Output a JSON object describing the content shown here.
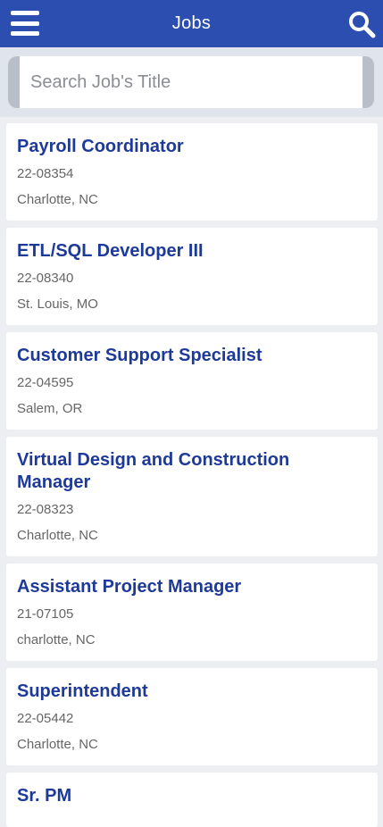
{
  "header": {
    "title": "Jobs",
    "menu_icon": "hamburger-menu-icon",
    "search_icon": "search-icon",
    "bar_color": "#2b4eb0"
  },
  "search": {
    "placeholder": "Search Job's Title",
    "value": ""
  },
  "jobs": [
    {
      "title": "Payroll Coordinator",
      "code": "22-08354",
      "location": "Charlotte, NC"
    },
    {
      "title": "ETL/SQL Developer III",
      "code": "22-08340",
      "location": "St. Louis, MO"
    },
    {
      "title": "Customer Support Specialist",
      "code": "22-04595",
      "location": "Salem, OR"
    },
    {
      "title": "Virtual Design and Construction Manager",
      "code": "22-08323",
      "location": "Charlotte, NC"
    },
    {
      "title": "Assistant Project Manager",
      "code": "21-07105",
      "location": "charlotte, NC"
    },
    {
      "title": "Superintendent",
      "code": "22-05442",
      "location": "Charlotte, NC"
    },
    {
      "title": "Sr. PM",
      "code": "",
      "location": ""
    }
  ]
}
